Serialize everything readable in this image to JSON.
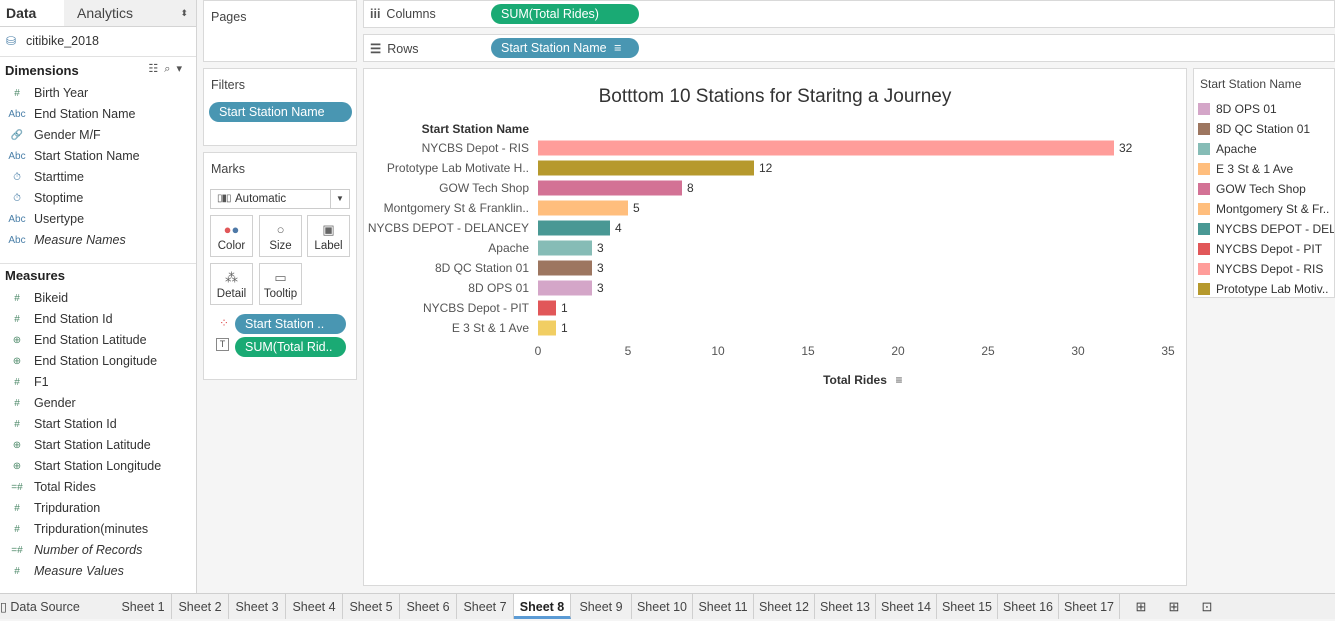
{
  "left_pane": {
    "tabs": {
      "data": "Data",
      "analytics": "Analytics"
    },
    "datasource": "citibike_2018",
    "dimensions_title": "Dimensions",
    "dimensions": [
      {
        "label": "Birth Year",
        "icon": "#"
      },
      {
        "label": "End Station Name",
        "icon": "Abc"
      },
      {
        "label": "Gender M/F",
        "icon": "🔗"
      },
      {
        "label": "Start Station Name",
        "icon": "Abc"
      },
      {
        "label": "Starttime",
        "icon": "⏱"
      },
      {
        "label": "Stoptime",
        "icon": "⏱"
      },
      {
        "label": "Usertype",
        "icon": "Abc"
      },
      {
        "label": "Measure Names",
        "icon": "Abc"
      }
    ],
    "measures_title": "Measures",
    "measures": [
      {
        "label": "Bikeid",
        "icon": "#"
      },
      {
        "label": "End Station Id",
        "icon": "#"
      },
      {
        "label": "End Station Latitude",
        "icon": "⊕"
      },
      {
        "label": "End Station Longitude",
        "icon": "⊕"
      },
      {
        "label": "F1",
        "icon": "#"
      },
      {
        "label": "Gender",
        "icon": "#"
      },
      {
        "label": "Start Station Id",
        "icon": "#"
      },
      {
        "label": "Start Station Latitude",
        "icon": "⊕"
      },
      {
        "label": "Start Station Longitude",
        "icon": "⊕"
      },
      {
        "label": "Total Rides",
        "icon": "=#"
      },
      {
        "label": "Tripduration",
        "icon": "#"
      },
      {
        "label": "Tripduration(minutes",
        "icon": "#"
      },
      {
        "label": "Number of Records",
        "icon": "=#"
      },
      {
        "label": "Measure Values",
        "icon": "#"
      }
    ]
  },
  "cards": {
    "pages_title": "Pages",
    "filters_title": "Filters",
    "filter_pill": "Start Station Name",
    "marks_title": "Marks",
    "mark_type": "Automatic",
    "mark_buttons": {
      "color": "Color",
      "size": "Size",
      "label": "Label",
      "detail": "Detail",
      "tooltip": "Tooltip"
    },
    "mark_pills": {
      "color_pill": "Start Station ..",
      "label_pill": "SUM(Total Rid.."
    }
  },
  "shelves": {
    "columns_title": "Columns",
    "columns_pill": "SUM(Total Rides)",
    "rows_title": "Rows",
    "rows_pill": "Start Station Name"
  },
  "chart_data": {
    "type": "bar",
    "orientation": "horizontal",
    "title": "Botttom 10 Stations for Staritng a Journey",
    "row_header": "Start Station Name",
    "xlabel": "Total Rides",
    "xlim": [
      0,
      35
    ],
    "xticks": [
      0,
      5,
      10,
      15,
      20,
      25,
      30,
      35
    ],
    "categories": [
      "NYCBS Depot - RIS",
      "Prototype Lab Motivate H..",
      "GOW Tech Shop",
      "Montgomery St & Franklin..",
      "NYCBS DEPOT - DELANCEY",
      "Apache",
      "8D QC Station 01",
      "8D OPS 01",
      "NYCBS Depot - PIT",
      "E 3 St & 1 Ave"
    ],
    "values": [
      32,
      12,
      8,
      5,
      4,
      3,
      3,
      3,
      1,
      1
    ],
    "colors": [
      "#ff9d9a",
      "#b6992d",
      "#d37295",
      "#ffbe7d",
      "#499894",
      "#86bcb6",
      "#9d7660",
      "#d4a6c8",
      "#e15759",
      "#f1ce63"
    ],
    "grid": false,
    "legend_position": "right"
  },
  "legend": {
    "title": "Start Station Name",
    "items": [
      {
        "label": "8D OPS 01",
        "color": "#d4a6c8"
      },
      {
        "label": "8D QC Station 01",
        "color": "#9d7660"
      },
      {
        "label": "Apache",
        "color": "#86bcb6"
      },
      {
        "label": "E 3 St & 1 Ave",
        "color": "#ffbe7d"
      },
      {
        "label": "GOW Tech Shop",
        "color": "#d37295"
      },
      {
        "label": "Montgomery St & Fr..",
        "color": "#ffbe7d"
      },
      {
        "label": "NYCBS DEPOT - DELA..",
        "color": "#499894"
      },
      {
        "label": "NYCBS Depot - PIT",
        "color": "#e15759"
      },
      {
        "label": "NYCBS Depot - RIS",
        "color": "#ff9d9a"
      },
      {
        "label": "Prototype Lab Motiv..",
        "color": "#b6992d"
      }
    ]
  },
  "sheet_tabs": {
    "data_source": "Data Source",
    "sheets": [
      "Sheet 1",
      "Sheet 2",
      "Sheet 3",
      "Sheet 4",
      "Sheet 5",
      "Sheet 6",
      "Sheet 7",
      "Sheet 8",
      "Sheet 9",
      "Sheet 10",
      "Sheet 11",
      "Sheet 12",
      "Sheet 13",
      "Sheet 14",
      "Sheet 15",
      "Sheet 16",
      "Sheet 17"
    ],
    "active": "Sheet 8"
  }
}
